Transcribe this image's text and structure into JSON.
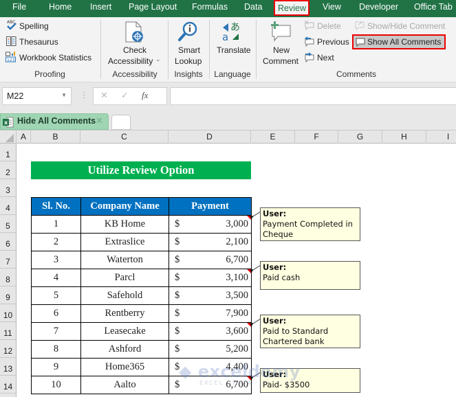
{
  "menu_tabs": [
    {
      "label": "File"
    },
    {
      "label": "Home"
    },
    {
      "label": "Insert"
    },
    {
      "label": "Page Layout"
    },
    {
      "label": "Formulas"
    },
    {
      "label": "Data"
    },
    {
      "label": "Review",
      "active": true
    },
    {
      "label": "View"
    },
    {
      "label": "Developer"
    },
    {
      "label": "Office Tab"
    }
  ],
  "ribbon": {
    "proofing": {
      "spelling": "Spelling",
      "thesaurus": "Thesaurus",
      "workbook_statistics": "Workbook Statistics",
      "group_label": "Proofing"
    },
    "accessibility": {
      "check_line1": "Check",
      "check_line2": "Accessibility",
      "group_label": "Accessibility"
    },
    "insights": {
      "smart_line1": "Smart",
      "smart_line2": "Lookup",
      "group_label": "Insights"
    },
    "language": {
      "translate": "Translate",
      "group_label": "Language"
    },
    "comments": {
      "new_line1": "New",
      "new_line2": "Comment",
      "delete": "Delete",
      "previous": "Previous",
      "next": "Next",
      "show_hide": "Show/Hide Comment",
      "show_all": "Show All Comments",
      "group_label": "Comments"
    }
  },
  "formula_bar": {
    "name_box": "M22",
    "cancel_symbol": "✕",
    "enter_symbol": "✓",
    "fx_label": "fx",
    "formula": ""
  },
  "workbook_tab": {
    "name": "Hide All Comments"
  },
  "columns": [
    "A",
    "B",
    "C",
    "D",
    "E",
    "F",
    "G",
    "H",
    "I"
  ],
  "rows": [
    "1",
    "2",
    "3",
    "4",
    "5",
    "6",
    "7",
    "8",
    "9",
    "10",
    "11",
    "12",
    "13",
    "14"
  ],
  "sheet": {
    "title": "Utilize Review Option",
    "headers": [
      "Sl. No.",
      "Company Name",
      "Payment"
    ],
    "currency": "$",
    "records": [
      {
        "no": "1",
        "company": "KB Home",
        "payment": "3,000",
        "has_comment": true
      },
      {
        "no": "2",
        "company": "Extraslice",
        "payment": "2,100",
        "has_comment": false
      },
      {
        "no": "3",
        "company": "Waterton",
        "payment": "6,700",
        "has_comment": false
      },
      {
        "no": "4",
        "company": "Parcl",
        "payment": "3,100",
        "has_comment": true
      },
      {
        "no": "5",
        "company": "Safehold",
        "payment": "3,500",
        "has_comment": false
      },
      {
        "no": "6",
        "company": "Rentberry",
        "payment": "7,900",
        "has_comment": false
      },
      {
        "no": "7",
        "company": "Leasecake",
        "payment": "3,600",
        "has_comment": true
      },
      {
        "no": "8",
        "company": "Ashford",
        "payment": "5,200",
        "has_comment": false
      },
      {
        "no": "9",
        "company": "Home365",
        "payment": "4,400",
        "has_comment": false
      },
      {
        "no": "10",
        "company": "Aalto",
        "payment": "6,700",
        "has_comment": true
      }
    ]
  },
  "comments": [
    {
      "author": "User:",
      "text_lines": [
        "Payment Completed in",
        "Cheque"
      ]
    },
    {
      "author": "User:",
      "text_lines": [
        "Paid cash"
      ]
    },
    {
      "author": "User:",
      "text_lines": [
        "Paid to Standard",
        "Chartered bank"
      ]
    },
    {
      "author": "User:",
      "text_lines": [
        "Paid- $3500"
      ]
    }
  ],
  "watermark": {
    "brand": "exceldemy",
    "tagline": "EXCEL · DATA · BI"
  },
  "colors": {
    "excel_green": "#217346",
    "title_green": "#00b050",
    "header_blue": "#0070c0",
    "highlight_red": "#ee0000",
    "comment_bg": "#ffffe1"
  }
}
